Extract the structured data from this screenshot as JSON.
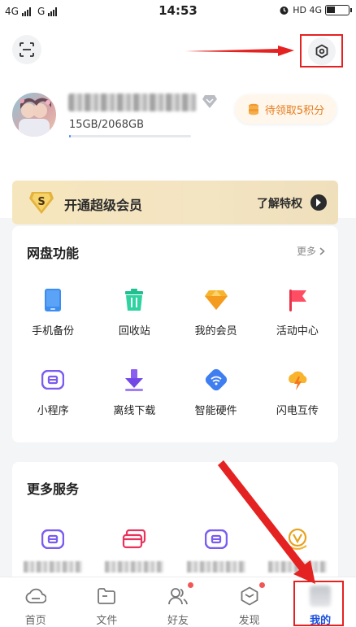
{
  "status_bar": {
    "left_text_1": "4G",
    "left_text_2": "G",
    "time": "14:53",
    "right_text": "HD 4G"
  },
  "header": {
    "scan_icon": "scan-icon",
    "settings_icon": "settings-gear-icon"
  },
  "profile": {
    "storage": "15GB/2068GB",
    "storage_used_fraction": 0.0073,
    "points_button": "待领取5积分"
  },
  "vip_banner": {
    "badge": "S",
    "title": "开通超级会员",
    "more": "了解特权"
  },
  "disk_card": {
    "title": "网盘功能",
    "more": "更多",
    "items": [
      {
        "label": "手机备份",
        "icon": "phone-backup-icon"
      },
      {
        "label": "回收站",
        "icon": "recycle-bin-icon"
      },
      {
        "label": "我的会员",
        "icon": "membership-diamond-icon"
      },
      {
        "label": "活动中心",
        "icon": "activity-flag-icon"
      },
      {
        "label": "小程序",
        "icon": "mini-program-icon"
      },
      {
        "label": "离线下载",
        "icon": "offline-download-icon"
      },
      {
        "label": "智能硬件",
        "icon": "smart-hardware-icon"
      },
      {
        "label": "闪电互传",
        "icon": "lightning-transfer-icon"
      }
    ]
  },
  "more_services_card": {
    "title": "更多服务"
  },
  "tabbar": {
    "tabs": [
      {
        "label": "首页",
        "icon": "home-cloud-icon"
      },
      {
        "label": "文件",
        "icon": "folder-icon"
      },
      {
        "label": "好友",
        "icon": "friends-icon"
      },
      {
        "label": "发现",
        "icon": "discover-cube-icon"
      },
      {
        "label": "我的",
        "icon": "mine-icon"
      }
    ]
  },
  "colors": {
    "accent_blue": "#1a4fe0",
    "annotation_red": "#e52222",
    "points_orange": "#e57c1e",
    "vip_gold": "#f3e4c2"
  }
}
